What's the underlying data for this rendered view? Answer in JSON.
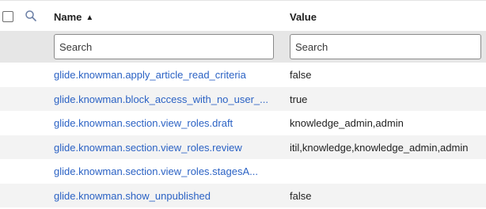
{
  "header": {
    "name_label": "Name",
    "value_label": "Value",
    "sort_indicator": "▲"
  },
  "search": {
    "name_placeholder": "Search",
    "value_placeholder": "Search"
  },
  "rows": [
    {
      "name": "glide.knowman.apply_article_read_criteria",
      "value": "false"
    },
    {
      "name": "glide.knowman.block_access_with_no_user_...",
      "value": "true"
    },
    {
      "name": "glide.knowman.section.view_roles.draft",
      "value": "knowledge_admin,admin"
    },
    {
      "name": "glide.knowman.section.view_roles.review",
      "value": "itil,knowledge,knowledge_admin,admin"
    },
    {
      "name": "glide.knowman.section.view_roles.stagesA...",
      "value": ""
    },
    {
      "name": "glide.knowman.show_unpublished",
      "value": "false"
    }
  ],
  "colors": {
    "link": "#2b62c4",
    "row_alt": "#f3f3f3",
    "search_bar": "#e6e6e6"
  },
  "icons": {
    "search_toggle": "search-icon",
    "select_all": "checkbox"
  }
}
